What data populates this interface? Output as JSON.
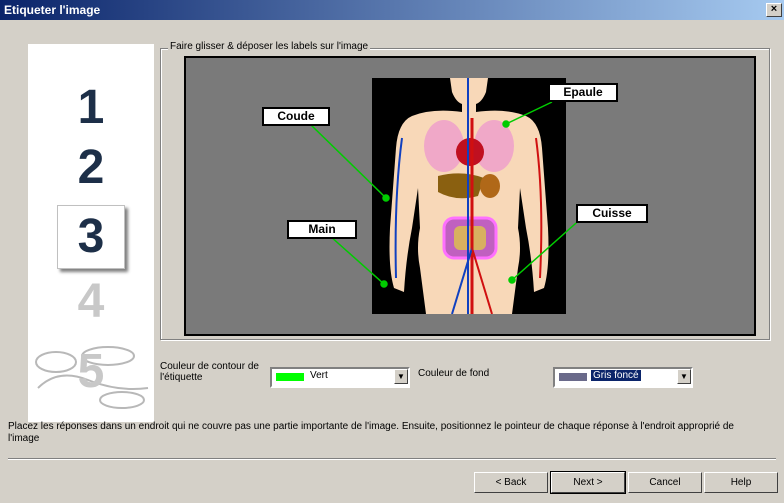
{
  "window": {
    "title": "Etiqueter l'image",
    "close_glyph": "×"
  },
  "steps": [
    "1",
    "2",
    "3",
    "4",
    "5"
  ],
  "active_step": "3",
  "group": {
    "legend": "Faire glisser & déposer les labels sur l'image"
  },
  "labels": [
    {
      "text": "Coude"
    },
    {
      "text": "Epaule"
    },
    {
      "text": "Main"
    },
    {
      "text": "Cuisse"
    }
  ],
  "outline_color": {
    "label": "Couleur de contour de l'étiquette",
    "value": "Vert",
    "swatch": "#00ff00"
  },
  "background_color": {
    "label": "Couleur de fond",
    "value": "Gris foncé",
    "swatch": "#6a6a8a"
  },
  "hint": "Placez les réponses dans un endroit qui ne couvre pas une partie importante de l'image. Ensuite, positionnez le pointeur de chaque réponse à l'endroit approprié de l'image",
  "buttons": {
    "back": "< Back",
    "next": "Next >",
    "cancel": "Cancel",
    "help": "Help"
  },
  "colors": {
    "leader_line": "#00cc00",
    "canvas": "#7a7a7a"
  }
}
